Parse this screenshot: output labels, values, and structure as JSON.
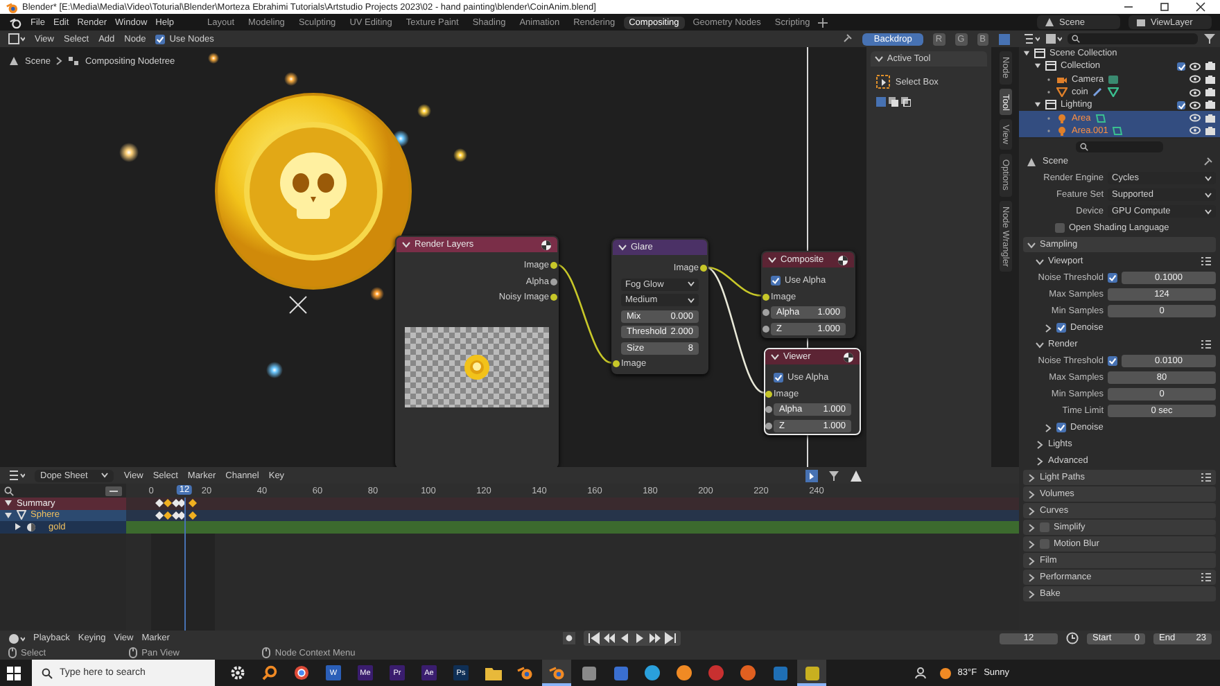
{
  "window": {
    "title": "Blender* [E:\\Media\\Media\\Video\\Toturial\\Blender\\Morteza Ebrahimi Tutorials\\Artstudio Projects 2023\\02 - hand painting\\blender\\CoinAnim.blend]"
  },
  "menu": [
    "File",
    "Edit",
    "Render",
    "Window",
    "Help"
  ],
  "workspaces": [
    {
      "label": "Layout",
      "selected": false
    },
    {
      "label": "Modeling",
      "selected": false
    },
    {
      "label": "Sculpting",
      "selected": false
    },
    {
      "label": "UV Editing",
      "selected": false
    },
    {
      "label": "Texture Paint",
      "selected": false
    },
    {
      "label": "Shading",
      "selected": false
    },
    {
      "label": "Animation",
      "selected": false
    },
    {
      "label": "Rendering",
      "selected": false
    },
    {
      "label": "Compositing",
      "selected": true
    },
    {
      "label": "Geometry Nodes",
      "selected": false
    },
    {
      "label": "Scripting",
      "selected": false
    }
  ],
  "top_right": {
    "scene": "Scene",
    "view_layer": "ViewLayer"
  },
  "node_editor": {
    "menu": [
      "View",
      "Select",
      "Add",
      "Node"
    ],
    "use_nodes": {
      "label": "Use Nodes",
      "checked": true
    },
    "backdrop": {
      "label": "Backdrop",
      "on": true
    },
    "channels": [
      "R",
      "G",
      "B"
    ],
    "breadcrumb": [
      "Scene",
      "Compositing Nodetree"
    ],
    "nodes": [
      {
        "title": "Render Layers",
        "kind": "render_layers",
        "color": "#7a2e48",
        "selected": false,
        "rows": [
          {
            "kind": "output",
            "label": "Image",
            "color": "#c7c729"
          },
          {
            "kind": "output",
            "label": "Alpha",
            "color": "#a1a1a1"
          },
          {
            "kind": "output",
            "label": "Noisy Image",
            "color": "#c7c729"
          },
          {
            "kind": "preview"
          }
        ]
      },
      {
        "title": "Glare",
        "kind": "glare",
        "color": "#4b3166",
        "selected": false,
        "rows": [
          {
            "kind": "output",
            "label": "Image",
            "color": "#c7c729"
          },
          {
            "kind": "dropdown",
            "value": "Fog Glow"
          },
          {
            "kind": "dropdown",
            "value": "Medium"
          },
          {
            "kind": "value",
            "label": "Mix",
            "value": "0.000"
          },
          {
            "kind": "value",
            "label": "Threshold",
            "value": "2.000"
          },
          {
            "kind": "value",
            "label": "Size",
            "value": "8"
          },
          {
            "kind": "input",
            "label": "Image",
            "color": "#c7c729"
          }
        ]
      },
      {
        "title": "Composite",
        "kind": "composite",
        "color": "#5c2434",
        "selected": false,
        "rows": [
          {
            "kind": "checkbox",
            "label": "Use Alpha",
            "checked": true
          },
          {
            "kind": "input",
            "label": "Image",
            "color": "#c7c729"
          },
          {
            "kind": "input_value",
            "label": "Alpha",
            "value": "1.000",
            "color": "#a1a1a1"
          },
          {
            "kind": "input_value",
            "label": "Z",
            "value": "1.000",
            "color": "#a1a1a1"
          }
        ]
      },
      {
        "title": "Viewer",
        "kind": "viewer",
        "color": "#5c2434",
        "selected": true,
        "rows": [
          {
            "kind": "checkbox",
            "label": "Use Alpha",
            "checked": true
          },
          {
            "kind": "input",
            "label": "Image",
            "color": "#c7c729"
          },
          {
            "kind": "input_value",
            "label": "Alpha",
            "value": "1.000",
            "color": "#a1a1a1"
          },
          {
            "kind": "input_value",
            "label": "Z",
            "value": "1.000",
            "color": "#a1a1a1"
          }
        ]
      }
    ]
  },
  "sidebar": {
    "tabs": [
      {
        "label": "Node",
        "selected": false
      },
      {
        "label": "Tool",
        "selected": true
      },
      {
        "label": "View",
        "selected": false
      },
      {
        "label": "Options",
        "selected": false
      },
      {
        "label": "Node Wrangler",
        "selected": false
      }
    ],
    "panel": {
      "title": "Active Tool",
      "expanded": true,
      "tool": "Select Box"
    }
  },
  "outliner": {
    "items": [
      {
        "label": "Scene Collection",
        "kind": "scene_collection",
        "selected": false,
        "expanded": true,
        "children": [
          {
            "label": "Collection",
            "kind": "collection",
            "selected": false,
            "expanded": true,
            "checked": true,
            "children": [
              {
                "label": "Camera",
                "kind": "camera",
                "selected": false
              },
              {
                "label": "coin",
                "kind": "mesh",
                "selected": false
              }
            ]
          },
          {
            "label": "Lighting",
            "kind": "collection",
            "selected": false,
            "expanded": true,
            "checked": true,
            "children": [
              {
                "label": "Area",
                "kind": "light",
                "selected": true
              },
              {
                "label": "Area.001",
                "kind": "light",
                "selected": true
              }
            ]
          }
        ]
      }
    ]
  },
  "properties": {
    "context": "Scene",
    "rows": [
      {
        "kind": "dropdown",
        "label": "Render Engine",
        "value": "Cycles"
      },
      {
        "kind": "dropdown",
        "label": "Feature Set",
        "value": "Supported"
      },
      {
        "kind": "dropdown",
        "label": "Device",
        "value": "GPU Compute"
      },
      {
        "kind": "checkbox",
        "label": "Open Shading Language",
        "checked": false
      },
      {
        "kind": "panel",
        "label": "Sampling",
        "expanded": true,
        "children": [
          {
            "kind": "panel",
            "label": "Viewport",
            "expanded": true,
            "presets": true,
            "children": [
              {
                "kind": "toggle_number",
                "label": "Noise Threshold",
                "checked": true,
                "value": "0.1000"
              },
              {
                "kind": "number",
                "label": "Max Samples",
                "value": "124"
              },
              {
                "kind": "number",
                "label": "Min Samples",
                "value": "0"
              },
              {
                "kind": "panel",
                "label": "Denoise",
                "expanded": false,
                "checked": true
              }
            ]
          },
          {
            "kind": "panel",
            "label": "Render",
            "expanded": true,
            "presets": true,
            "children": [
              {
                "kind": "toggle_number",
                "label": "Noise Threshold",
                "checked": true,
                "value": "0.0100"
              },
              {
                "kind": "number",
                "label": "Max Samples",
                "value": "80"
              },
              {
                "kind": "number",
                "label": "Min Samples",
                "value": "0"
              },
              {
                "kind": "number",
                "label": "Time Limit",
                "value": "0 sec"
              },
              {
                "kind": "panel",
                "label": "Denoise",
                "expanded": false,
                "checked": true
              }
            ]
          },
          {
            "kind": "panel",
            "label": "Lights",
            "expanded": false
          },
          {
            "kind": "panel",
            "label": "Advanced",
            "expanded": false
          }
        ]
      },
      {
        "kind": "panel",
        "label": "Light Paths",
        "expanded": false,
        "presets": true
      },
      {
        "kind": "panel",
        "label": "Volumes",
        "expanded": false
      },
      {
        "kind": "panel",
        "label": "Curves",
        "expanded": false
      },
      {
        "kind": "panel",
        "label": "Simplify",
        "expanded": false,
        "checked": false
      },
      {
        "kind": "panel",
        "label": "Motion Blur",
        "expanded": false,
        "checked": false
      },
      {
        "kind": "panel",
        "label": "Film",
        "expanded": false
      },
      {
        "kind": "panel",
        "label": "Performance",
        "expanded": false,
        "presets": true
      },
      {
        "kind": "panel",
        "label": "Bake",
        "expanded": false
      }
    ]
  },
  "dope_sheet": {
    "mode": "Dope Sheet",
    "menu": [
      "View",
      "Select",
      "Marker",
      "Channel",
      "Key"
    ],
    "current_frame": "12",
    "ruler": [
      "0",
      "20",
      "40",
      "60",
      "80",
      "100",
      "120",
      "140",
      "160",
      "180",
      "200",
      "220",
      "240"
    ],
    "channels": [
      {
        "label": "Summary",
        "kind": "summary",
        "expanded": true
      },
      {
        "label": "Sphere",
        "kind": "object",
        "expanded": true
      },
      {
        "label": "gold",
        "kind": "material",
        "expanded": false
      }
    ]
  },
  "timeline": {
    "menu": [
      "Playback",
      "Keying",
      "View",
      "Marker"
    ],
    "current_frame": "12",
    "start": {
      "label": "Start",
      "value": "0"
    },
    "end": {
      "label": "End",
      "value": "23"
    }
  },
  "status_bar": [
    "Select",
    "Pan View",
    "Node Context Menu"
  ],
  "taskbar": {
    "search": {
      "placeholder": "Type here to search"
    },
    "apps": [
      {
        "kind": "gear",
        "color": "#e6e6e6",
        "selected": false
      },
      {
        "kind": "ring",
        "color": "#f08a24",
        "selected": false
      },
      {
        "kind": "browser",
        "color": "#dd4b39",
        "selected": false
      },
      {
        "kind": "letter",
        "label": "W",
        "color": "#2b5fb8",
        "selected": false
      },
      {
        "kind": "letter",
        "label": "Me",
        "color": "#3a1d6e",
        "selected": false
      },
      {
        "kind": "letter",
        "label": "Pr",
        "color": "#3a1d6e",
        "selected": false
      },
      {
        "kind": "letter",
        "label": "Ae",
        "color": "#3a1d6e",
        "selected": false
      },
      {
        "kind": "letter",
        "label": "Ps",
        "color": "#0f2f55",
        "selected": false
      },
      {
        "kind": "folder",
        "color": "#e8b93a",
        "selected": false
      },
      {
        "kind": "orbit",
        "color": "#f08a24",
        "selected": false
      },
      {
        "kind": "orbit",
        "color": "#f08a24",
        "selected": true
      },
      {
        "kind": "square",
        "color": "#8a8a8a",
        "selected": false
      },
      {
        "kind": "square",
        "color": "#3a6fd0",
        "selected": false
      },
      {
        "kind": "circle",
        "color": "#2aa0dc",
        "selected": false
      },
      {
        "kind": "circle",
        "color": "#f08a24",
        "selected": false
      },
      {
        "kind": "circle",
        "color": "#c83030",
        "selected": false
      },
      {
        "kind": "circle",
        "color": "#e06020",
        "selected": false
      },
      {
        "kind": "square",
        "color": "#1f6fb5",
        "selected": false
      },
      {
        "kind": "square",
        "color": "#c8b020",
        "selected": true
      }
    ],
    "weather": {
      "temperature": "83°F",
      "condition": "Sunny"
    }
  }
}
